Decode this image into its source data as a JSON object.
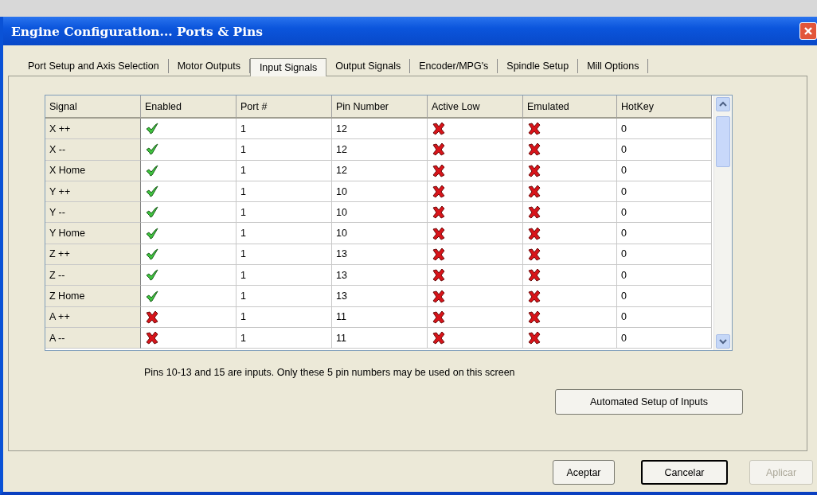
{
  "window": {
    "title": "Engine Configuration... Ports & Pins"
  },
  "tabs": [
    {
      "label": "Port Setup and Axis Selection",
      "selected": false
    },
    {
      "label": "Motor Outputs",
      "selected": false
    },
    {
      "label": "Input Signals",
      "selected": true
    },
    {
      "label": "Output Signals",
      "selected": false
    },
    {
      "label": "Encoder/MPG's",
      "selected": false
    },
    {
      "label": "Spindle Setup",
      "selected": false
    },
    {
      "label": "Mill Options",
      "selected": false
    }
  ],
  "table": {
    "columns": [
      "Signal",
      "Enabled",
      "Port #",
      "Pin Number",
      "Active Low",
      "Emulated",
      "HotKey"
    ],
    "rows": [
      {
        "signal": "X ++",
        "enabled": true,
        "port": "1",
        "pin": "12",
        "active_low": false,
        "emulated": false,
        "hotkey": "0"
      },
      {
        "signal": "X --",
        "enabled": true,
        "port": "1",
        "pin": "12",
        "active_low": false,
        "emulated": false,
        "hotkey": "0"
      },
      {
        "signal": "X Home",
        "enabled": true,
        "port": "1",
        "pin": "12",
        "active_low": false,
        "emulated": false,
        "hotkey": "0"
      },
      {
        "signal": "Y ++",
        "enabled": true,
        "port": "1",
        "pin": "10",
        "active_low": false,
        "emulated": false,
        "hotkey": "0"
      },
      {
        "signal": "Y --",
        "enabled": true,
        "port": "1",
        "pin": "10",
        "active_low": false,
        "emulated": false,
        "hotkey": "0"
      },
      {
        "signal": "Y Home",
        "enabled": true,
        "port": "1",
        "pin": "10",
        "active_low": false,
        "emulated": false,
        "hotkey": "0"
      },
      {
        "signal": "Z ++",
        "enabled": true,
        "port": "1",
        "pin": "13",
        "active_low": false,
        "emulated": false,
        "hotkey": "0"
      },
      {
        "signal": "Z --",
        "enabled": true,
        "port": "1",
        "pin": "13",
        "active_low": false,
        "emulated": false,
        "hotkey": "0"
      },
      {
        "signal": "Z Home",
        "enabled": true,
        "port": "1",
        "pin": "13",
        "active_low": false,
        "emulated": false,
        "hotkey": "0"
      },
      {
        "signal": "A ++",
        "enabled": false,
        "port": "1",
        "pin": "11",
        "active_low": false,
        "emulated": false,
        "hotkey": "0"
      },
      {
        "signal": "A --",
        "enabled": false,
        "port": "1",
        "pin": "11",
        "active_low": false,
        "emulated": false,
        "hotkey": "0"
      }
    ]
  },
  "note": "Pins 10-13 and 15 are inputs. Only these 5 pin numbers may be used on this screen",
  "automated_button": "Automated Setup of Inputs",
  "buttons": [
    {
      "label": "Aceptar",
      "disabled": false,
      "default": false
    },
    {
      "label": "Cancelar",
      "disabled": false,
      "default": true
    },
    {
      "label": "Aplicar",
      "disabled": true,
      "default": false
    }
  ]
}
